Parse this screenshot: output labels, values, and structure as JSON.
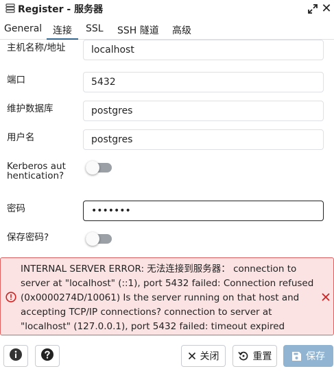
{
  "window": {
    "title": "Register - 服务器",
    "close_glyph": "✕"
  },
  "tabs": [
    {
      "label": "General",
      "active": false
    },
    {
      "label": "连接",
      "active": true
    },
    {
      "label": "SSL",
      "active": false
    },
    {
      "label": "SSH 隧道",
      "active": false
    },
    {
      "label": "高级",
      "active": false
    }
  ],
  "form": {
    "host": {
      "label": "主机名称/地址",
      "value": "localhost"
    },
    "port": {
      "label": "端口",
      "value": "5432"
    },
    "maintenance_db": {
      "label": "维护数据库",
      "value": "postgres"
    },
    "username": {
      "label": "用户名",
      "value": "postgres"
    },
    "kerberos": {
      "label": "Kerberos authentication?",
      "enabled": false
    },
    "password": {
      "label": "密码",
      "value": "•••••••"
    },
    "save_password": {
      "label": "保存密码?",
      "enabled": false
    }
  },
  "error": {
    "message": "INTERNAL SERVER ERROR: 无法连接到服务器： connection to server at \"localhost\" (::1), port 5432 failed: Connection refused (0x0000274D/10061) Is the server running on that host and accepting TCP/IP connections? connection to server at \"localhost\" (127.0.0.1), port 5432 failed: timeout expired"
  },
  "footer": {
    "close_label": "关闭",
    "reset_label": "重置",
    "save_label": "保存"
  },
  "colors": {
    "accent": "#326690",
    "error_bg": "#fbe3e3",
    "error_border": "#e06060",
    "save_disabled": "#90b4d1"
  }
}
